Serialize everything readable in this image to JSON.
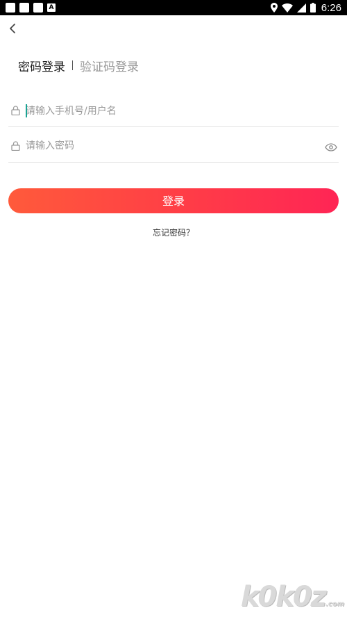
{
  "status_bar": {
    "time": "6:26",
    "notification_badge": "A",
    "icons": [
      "image-icon",
      "image-icon",
      "image-icon",
      "a-badge-icon",
      "location-icon",
      "wifi-icon",
      "signal-icon",
      "battery-icon"
    ]
  },
  "header": {
    "back_icon": "chevron-left-icon"
  },
  "tabs": {
    "password_login": "密码登录",
    "code_login": "验证码登录"
  },
  "form": {
    "username_placeholder": "请输入手机号/用户名",
    "username_value": "",
    "password_placeholder": "请输入密码",
    "password_value": "",
    "lock_icon": "lock-icon",
    "eye_icon": "eye-icon"
  },
  "login_button": {
    "label": "登录",
    "gradient_start": "#ff5a3b",
    "gradient_end": "#ff2555"
  },
  "forgot_password": "忘记密码？",
  "watermark": {
    "text": "k0k0z",
    "suffix": ".com"
  }
}
